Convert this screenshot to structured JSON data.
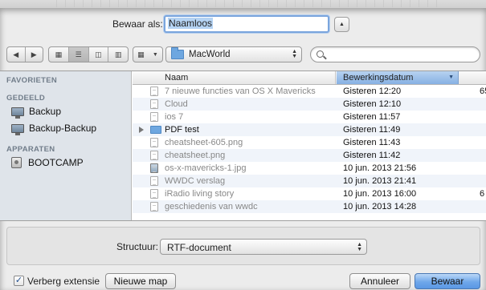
{
  "save_as": {
    "label": "Bewaar als:",
    "filename": "Naamloos"
  },
  "toolbar": {
    "back_icon": "chevron-left-icon",
    "forward_icon": "chevron-right-icon",
    "location": "MacWorld",
    "search_value": ""
  },
  "sidebar": {
    "favorites_heading": "FAVORIETEN",
    "shared_heading": "GEDEELD",
    "shared_items": [
      {
        "label": "Backup",
        "icon": "monitor-icon"
      },
      {
        "label": "Backup-Backup",
        "icon": "monitor-icon"
      }
    ],
    "devices_heading": "APPARATEN",
    "device_items": [
      {
        "label": "BOOTCAMP",
        "icon": "disk-icon"
      }
    ]
  },
  "filelist": {
    "col_name": "Naam",
    "col_date": "Bewerkingsdatum",
    "rows": [
      {
        "name": "7 nieuwe functies van OS X Mavericks",
        "date": "Gisteren 12:20",
        "extra": "65"
      },
      {
        "name": "Cloud",
        "date": "Gisteren 12:10",
        "extra": ""
      },
      {
        "name": "ios 7",
        "date": "Gisteren 11:57",
        "extra": ""
      },
      {
        "name": "PDF test",
        "date": "Gisteren 11:49",
        "extra": ""
      },
      {
        "name": "cheatsheet-605.png",
        "date": "Gisteren 11:43",
        "extra": ""
      },
      {
        "name": "cheatsheet.png",
        "date": "Gisteren 11:42",
        "extra": ""
      },
      {
        "name": "os-x-mavericks-1.jpg",
        "date": "10 jun. 2013 21:56",
        "extra": ""
      },
      {
        "name": "WWDC verslag",
        "date": "10 jun. 2013 21:41",
        "extra": ""
      },
      {
        "name": "iRadio living story",
        "date": "10 jun. 2013 16:00",
        "extra": "6"
      },
      {
        "name": "geschiedenis van wwdc",
        "date": "10 jun. 2013 14:28",
        "extra": ""
      }
    ]
  },
  "options": {
    "format_label": "Structuur:",
    "format_value": "RTF-document"
  },
  "bottom": {
    "hide_extension_label": "Verberg extensie",
    "hide_extension_checked": "✓",
    "new_folder_label": "Nieuwe map",
    "cancel_label": "Annuleer",
    "save_label": "Bewaar"
  },
  "colors": {
    "accent": "#6fa7ea",
    "sidebar_bg": "#dfe4ea",
    "sort_header": "#86b0e3"
  }
}
